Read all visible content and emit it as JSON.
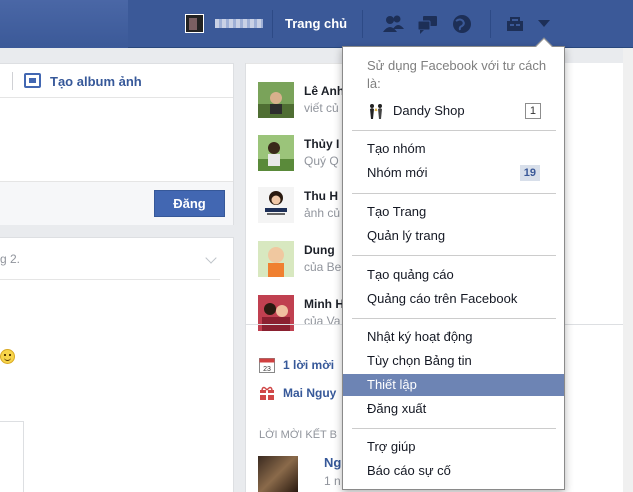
{
  "topbar": {
    "home_label": "Trang chủ"
  },
  "composer": {
    "album_label": "Tạo album ảnh",
    "post_label": "Đăng"
  },
  "feed": {
    "meta_text": "g 2."
  },
  "right_column": {
    "friends": [
      {
        "name": "Lê Anh",
        "sub": "viết củ"
      },
      {
        "name": "Thủy I",
        "sub": "Quý Q"
      },
      {
        "name": "Thu H",
        "sub": "ảnh củ"
      },
      {
        "name": "Dung",
        "sub": "của Be"
      },
      {
        "name": "Minh H",
        "sub": "của Va"
      }
    ],
    "events": [
      {
        "label": "1 lời mời",
        "icon": "calendar-icon",
        "icon_text": "23"
      },
      {
        "label": "Mai Nguy",
        "icon": "gift-icon"
      }
    ],
    "invites_title": "LỜI MỜI KẾT B",
    "invite": {
      "name": "Ng",
      "sub": "1 n"
    }
  },
  "menu": {
    "header": "Sử dụng Facebook với tư cách là:",
    "page_item": {
      "label": "Dandy Shop",
      "badge": "1"
    },
    "groups": [
      [
        {
          "label": "Tạo nhóm"
        },
        {
          "label": "Nhóm mới",
          "badge": "19"
        }
      ],
      [
        {
          "label": "Tạo Trang"
        },
        {
          "label": "Quản lý trang"
        }
      ],
      [
        {
          "label": "Tạo quảng cáo"
        },
        {
          "label": "Quảng cáo trên Facebook"
        }
      ],
      [
        {
          "label": "Nhật ký hoạt động"
        },
        {
          "label": "Tùy chọn Bảng tin"
        },
        {
          "label": "Thiết lập",
          "active": true
        },
        {
          "label": "Đăng xuất"
        }
      ],
      [
        {
          "label": "Trợ giúp"
        },
        {
          "label": "Báo cáo sự cố"
        }
      ]
    ]
  },
  "colors": {
    "brand_blue": "#3b5998",
    "button_blue": "#4267b2",
    "menu_highlight": "#6d84b4",
    "link_blue": "#365899"
  }
}
